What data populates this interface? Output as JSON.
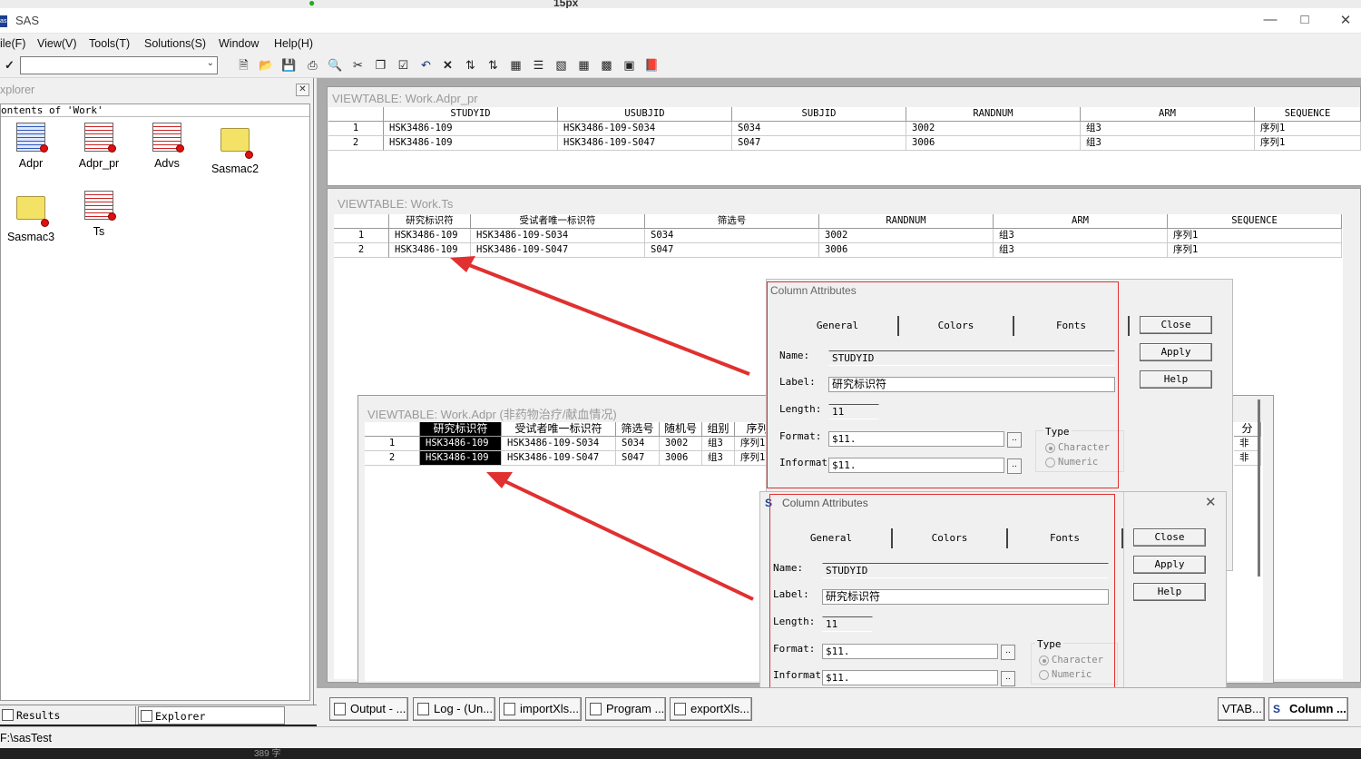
{
  "app": {
    "title": "SAS",
    "logo": "sas"
  },
  "top_strip": {
    "font_size": "15px"
  },
  "menu": [
    "ile(F)",
    "View(V)",
    "Tools(T)",
    "Solutions(S)",
    "Window",
    "Help(H)"
  ],
  "explorer": {
    "title": "xplorer",
    "contents_header": "ontents of 'Work'",
    "items": [
      {
        "name": "Adpr",
        "kind": "table-icon"
      },
      {
        "name": "Adpr_pr",
        "kind": "table-icon"
      },
      {
        "name": "Advs",
        "kind": "table-icon"
      },
      {
        "name": "Sasmac2",
        "kind": "folder-icon"
      },
      {
        "name": "Sasmac3",
        "kind": "folder-icon"
      },
      {
        "name": "Ts",
        "kind": "table-icon"
      }
    ],
    "tabs": {
      "results": "Results",
      "explorer": "Explorer"
    }
  },
  "vt1": {
    "title": "VIEWTABLE: Work.Adpr_pr",
    "headers": [
      "STUDYID",
      "USUBJID",
      "SUBJID",
      "RANDNUM",
      "ARM",
      "SEQUENCE"
    ],
    "rows": [
      [
        "1",
        "HSK3486-109",
        "HSK3486-109-S034",
        "S034",
        "3002",
        "组3",
        "序列1"
      ],
      [
        "2",
        "HSK3486-109",
        "HSK3486-109-S047",
        "S047",
        "3006",
        "组3",
        "序列1"
      ]
    ]
  },
  "vt2": {
    "title": "VIEWTABLE: Work.Ts",
    "headers": [
      "研究标识符",
      "受试者唯一标识符",
      "筛选号",
      "RANDNUM",
      "ARM",
      "SEQUENCE"
    ],
    "rows": [
      [
        "1",
        "HSK3486-109",
        "HSK3486-109-S034",
        "S034",
        "3002",
        "组3",
        "序列1"
      ],
      [
        "2",
        "HSK3486-109",
        "HSK3486-109-S047",
        "S047",
        "3006",
        "组3",
        "序列1"
      ]
    ]
  },
  "vt3": {
    "title": "VIEWTABLE: Work.Adpr (非药物治疗/献血情况)",
    "headers": [
      "研究标识符",
      "受试者唯一标识符",
      "筛选号",
      "随机号",
      "组别",
      "序列",
      "分"
    ],
    "rows": [
      [
        "1",
        "HSK3486-109",
        "HSK3486-109-S034",
        "S034",
        "3002",
        "组3",
        "序列1",
        "非"
      ],
      [
        "2",
        "HSK3486-109",
        "HSK3486-109-S047",
        "S047",
        "3006",
        "组3",
        "序列1",
        "非"
      ]
    ]
  },
  "dialog": {
    "title": "Column Attributes",
    "tabs": [
      "General",
      "Colors",
      "Fonts"
    ],
    "labels": {
      "name": "Name:",
      "label": "Label:",
      "length": "Length:",
      "format": "Format:",
      "informat": "Informat"
    },
    "values": {
      "name": "STUDYID",
      "label": "研究标识符",
      "length": "11",
      "format": "$11.",
      "informat": "$11."
    },
    "type_title": "Type",
    "type_options": [
      "Character",
      "Numeric"
    ],
    "type_selected": "Character",
    "buttons": [
      "Close",
      "Apply",
      "Help"
    ],
    "dots": ".."
  },
  "taskbar": [
    "Output - ...",
    "Log - (Un...",
    "importXls...",
    "Program ...",
    "exportXls...",
    "VTAB...",
    "Column ..."
  ],
  "status": {
    "path": "F:\\sasTest"
  },
  "os": {
    "snippet": "389 字"
  },
  "colors": {
    "annotation": "#e03030",
    "selection": "#000000"
  }
}
